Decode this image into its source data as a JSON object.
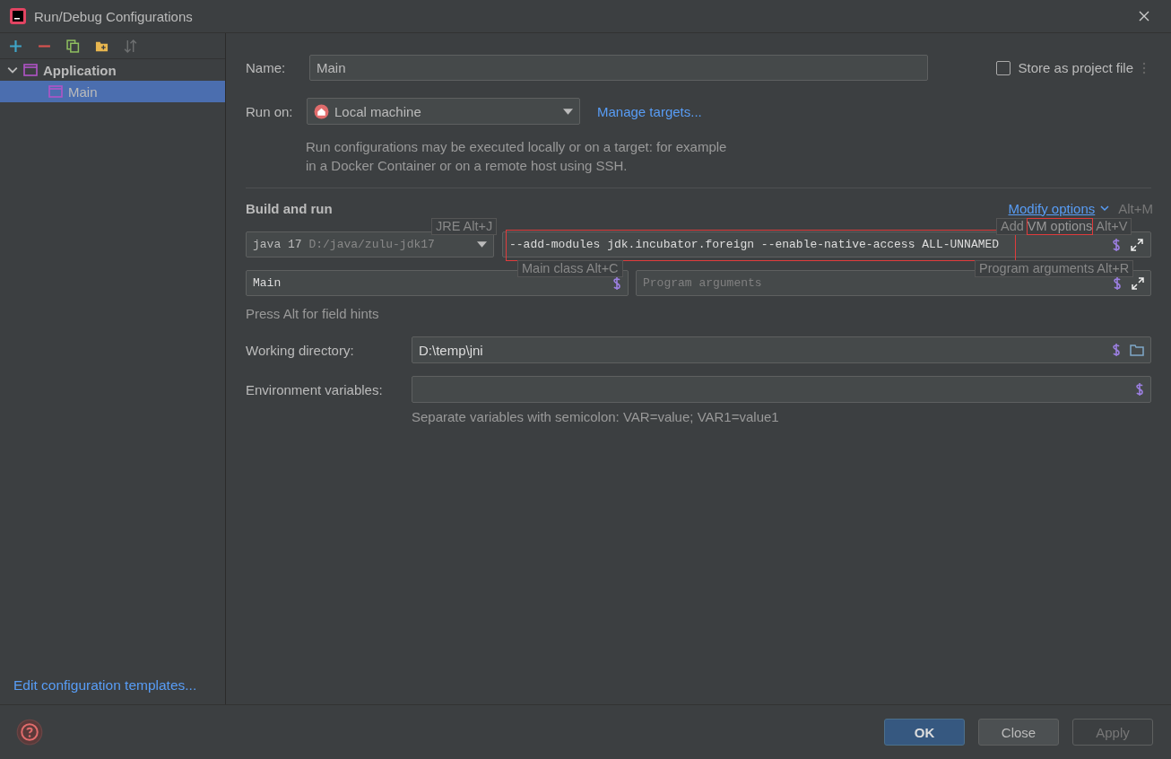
{
  "window": {
    "title": "Run/Debug Configurations"
  },
  "toolbar": [
    {
      "kind": "add",
      "disabled": false
    },
    {
      "kind": "remove",
      "disabled": false
    },
    {
      "kind": "copy",
      "disabled": false
    },
    {
      "kind": "folder",
      "disabled": false
    },
    {
      "kind": "sort",
      "disabled": true
    }
  ],
  "tree": [
    {
      "label": "Application",
      "expanded": true,
      "selected": false,
      "children": [
        {
          "label": "Main",
          "selected": true
        }
      ]
    }
  ],
  "templates_link": "Edit configuration templates...",
  "name": {
    "label": "Name:",
    "value": "Main"
  },
  "store": {
    "label": "Store as project file",
    "checked": false
  },
  "run_on": {
    "label": "Run on:",
    "value": "Local machine",
    "link": "Manage targets...",
    "description": "Run configurations may be executed locally or on a target: for example in a Docker Container or on a remote host using SSH."
  },
  "build": {
    "title": "Build and run",
    "modify_link": "Modify options",
    "modify_shortcut": "Alt+M",
    "jre": {
      "value": "java 17",
      "path": "D:/java/zulu-jdk17"
    },
    "vm_options": {
      "value": "--add-modules jdk.incubator.foreign --enable-native-access ALL-UNNAMED",
      "highlighted": true
    },
    "main_class": {
      "value": "Main"
    },
    "program_arguments": {
      "placeholder": "Program arguments"
    },
    "hint": "Press Alt for field hints"
  },
  "tooltips": [
    {
      "parts": [
        {
          "text": "JRE Alt+J",
          "highlighted": false
        }
      ]
    },
    {
      "parts": [
        {
          "text": "Main class Alt+C",
          "highlighted": false
        }
      ]
    },
    {
      "parts": [
        {
          "text": "Add",
          "highlighted": false
        },
        {
          "text": "VM options",
          "highlighted": true
        },
        {
          "text": "Alt+V",
          "highlighted": false
        }
      ]
    },
    {
      "parts": [
        {
          "text": "Program arguments Alt+R",
          "highlighted": false
        }
      ]
    }
  ],
  "working_directory": {
    "label": "Working directory:",
    "value": "D:\\temp\\jni"
  },
  "environment": {
    "label": "Environment variables:",
    "hint": "Separate variables with semicolon: VAR=value; VAR1=value1"
  },
  "buttons": [
    {
      "label": "OK",
      "primary": true
    },
    {
      "label": "Close",
      "primary": false
    },
    {
      "label": "Apply",
      "primary": false,
      "disabled": true
    }
  ]
}
